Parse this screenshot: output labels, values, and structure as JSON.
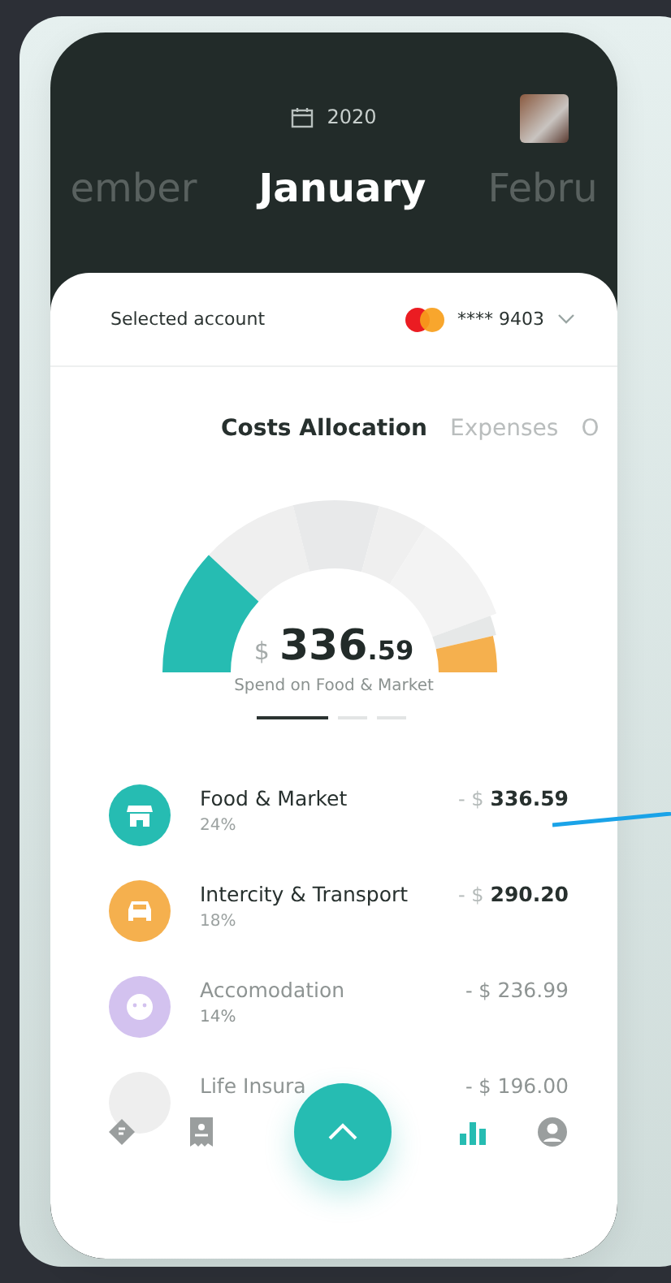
{
  "header": {
    "year": "2020",
    "months": [
      {
        "label": "ember",
        "selected": false
      },
      {
        "label": "January",
        "selected": true
      },
      {
        "label": "Febru",
        "selected": false
      }
    ]
  },
  "account": {
    "label": "Selected account",
    "number": "**** 9403"
  },
  "tabs": [
    {
      "label": "Costs Allocation",
      "selected": true
    },
    {
      "label": "Expenses",
      "selected": false
    },
    {
      "label": "O",
      "selected": false
    }
  ],
  "summary": {
    "currency": "$",
    "amount": "336",
    "cents": ".59",
    "caption": "Spend on Food & Market"
  },
  "pager": [
    {
      "selected": true
    },
    {
      "selected": false
    },
    {
      "selected": false
    }
  ],
  "categories": [
    {
      "kind": "store",
      "name": "Food & Market",
      "percent": "24%",
      "prefix": "- $",
      "amount": "336.59",
      "color": "#26bcb2",
      "dimmed": false
    },
    {
      "kind": "car",
      "name": "Intercity & Transport",
      "percent": "18%",
      "prefix": "- $",
      "amount": "290.20",
      "color": "#f5b04e",
      "dimmed": false
    },
    {
      "kind": "face",
      "name": "Accomodation",
      "percent": "14%",
      "prefix": "- $",
      "amount": "236.99",
      "color": "#d3c2ef",
      "dimmed": true
    },
    {
      "kind": "blank",
      "name": "Life Insura",
      "prefix": "- $",
      "amount": "196.00",
      "color": "#eeeeee",
      "dimmed": true
    }
  ],
  "nav": [
    {
      "kind": "tag",
      "selected": false
    },
    {
      "kind": "receipt",
      "selected": false
    },
    {
      "kind": "fab",
      "selected": false
    },
    {
      "kind": "chart",
      "selected": true
    },
    {
      "kind": "profile",
      "selected": false
    }
  ]
}
